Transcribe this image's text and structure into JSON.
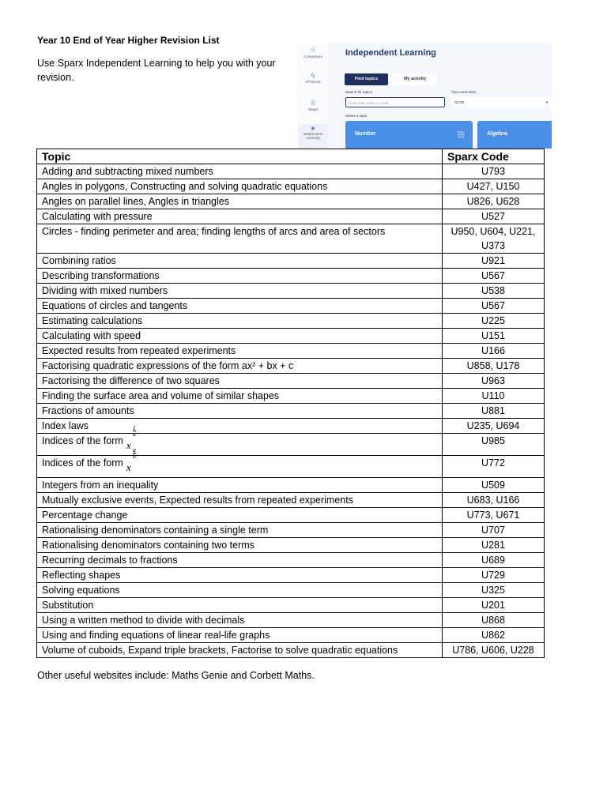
{
  "title": "Year 10 End of Year Higher Revision List",
  "intro": "Use Sparx Independent Learning to help you with your revision.",
  "screenshot": {
    "sidebar": [
      {
        "icon": "star-icon",
        "glyph": "☆",
        "label": "Compulsory"
      },
      {
        "icon": "lightning-icon",
        "glyph": "ϟ",
        "label": "XP Boost"
      },
      {
        "icon": "crown-icon",
        "glyph": "♕",
        "label": "Target"
      },
      {
        "icon": "bulb-icon",
        "glyph": "●",
        "label": "Independent Learning"
      }
    ],
    "heading": "Independent Learning",
    "tabs": [
      "Find topics",
      "My activity"
    ],
    "search_label": "Search for topics:",
    "search_placeholder": "Enter topic name or code",
    "curriculum_label": "Your curriculum:",
    "curriculum_value": "GCSE",
    "select_label": "Select a topic:",
    "cards": [
      "Number",
      "Algebra"
    ],
    "colors": {
      "navy": "#1f2f5c",
      "card": "#4a90e8"
    }
  },
  "table": {
    "headers": [
      "Topic",
      "Sparx Code"
    ],
    "rows": [
      {
        "topic": "Adding and subtracting mixed numbers",
        "code": "U793"
      },
      {
        "topic": "Angles in polygons, Constructing and solving quadratic equations",
        "code": "U427, U150"
      },
      {
        "topic": "Angles on parallel lines, Angles in triangles",
        "code": "U826, U628"
      },
      {
        "topic": "Calculating with pressure",
        "code": "U527"
      },
      {
        "topic": "Circles - finding perimeter and area; finding lengths of arcs and area of sectors",
        "code": "U950, U604, U221, U373"
      },
      {
        "topic": "Combining ratios",
        "code": "U921"
      },
      {
        "topic": "Describing transformations",
        "code": "U567"
      },
      {
        "topic": "Dividing with mixed numbers",
        "code": "U538"
      },
      {
        "topic": "Equations of circles and tangents",
        "code": "U567"
      },
      {
        "topic": "Estimating calculations",
        "code": "U225"
      },
      {
        "topic": "Calculating with speed",
        "code": "U151"
      },
      {
        "topic": "Expected results from repeated experiments",
        "code": "U166"
      },
      {
        "topic": "Factorising quadratic expressions of the form ax² + bx + c",
        "code": "U858,  U178"
      },
      {
        "topic": "Factorising the difference of two squares",
        "code": "U963"
      },
      {
        "topic": "Finding the surface area and volume of similar shapes",
        "code": "U110"
      },
      {
        "topic": "Fractions of amounts",
        "code": "U881"
      },
      {
        "topic": "Index laws",
        "code": "U235, U694"
      },
      {
        "topic": "Indices of the form",
        "base": "x",
        "num": "1",
        "den": "a",
        "code": "U985"
      },
      {
        "topic": "Indices of the form",
        "base": "x",
        "num": "a",
        "den": "b",
        "code": "U772"
      },
      {
        "topic": "Integers from an inequality",
        "code": "U509"
      },
      {
        "topic": "Mutually exclusive events, Expected results from repeated experiments",
        "code": "U683, U166"
      },
      {
        "topic": "Percentage change",
        "code": "U773, U671"
      },
      {
        "topic": "Rationalising denominators containing a single term",
        "code": "U707"
      },
      {
        "topic": "Rationalising denominators containing two terms",
        "code": "U281"
      },
      {
        "topic": "Recurring decimals to fractions",
        "code": "U689"
      },
      {
        "topic": "Reflecting shapes",
        "code": "U729"
      },
      {
        "topic": "Solving equations",
        "code": "U325"
      },
      {
        "topic": "Substitution",
        "code": "U201"
      },
      {
        "topic": "Using a written method to divide with decimals",
        "code": "U868"
      },
      {
        "topic": "Using and finding equations of linear real-life graphs",
        "code": "U862"
      },
      {
        "topic": "Volume of cuboids, Expand triple brackets, Factorise to solve quadratic equations",
        "code": "U786, U606, U228"
      }
    ]
  },
  "footer": "Other useful websites include: Maths Genie and Corbett Maths."
}
